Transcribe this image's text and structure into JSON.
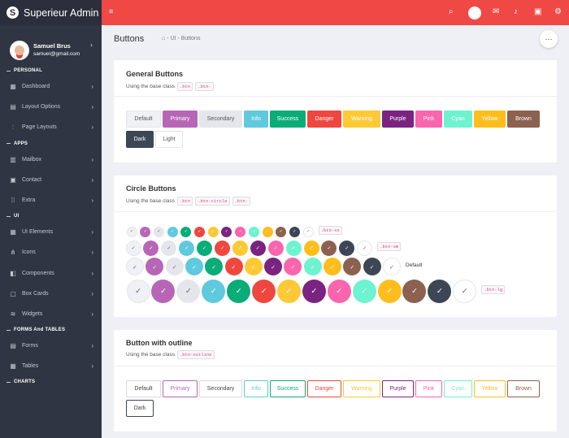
{
  "app": {
    "title": "Superieur Admin"
  },
  "user": {
    "name": "Samuel Brus",
    "email": "samuel@gmail.com"
  },
  "sidebar": {
    "sections": [
      "PERSONAL",
      "APPS",
      "UI",
      "FORMS And TABLES",
      "CHARTS"
    ],
    "items": [
      {
        "label": "Dashboard",
        "icon": "grid"
      },
      {
        "label": "Layout Options",
        "icon": "layout"
      },
      {
        "label": "Page Layouts",
        "icon": "sliders"
      },
      {
        "label": "Mailbox",
        "icon": "inbox"
      },
      {
        "label": "Contact",
        "icon": "id-card"
      },
      {
        "label": "Extra",
        "icon": "apps"
      },
      {
        "label": "UI Elements",
        "icon": "layers"
      },
      {
        "label": "Icons",
        "icon": "share"
      },
      {
        "label": "Components",
        "icon": "toggle"
      },
      {
        "label": "Box Cards",
        "icon": "cards"
      },
      {
        "label": "Widgets",
        "icon": "waves"
      },
      {
        "label": "Forms",
        "icon": "form"
      },
      {
        "label": "Tables",
        "icon": "table"
      }
    ]
  },
  "page": {
    "title": "Buttons",
    "breadcrumb": [
      "UI",
      "Buttons"
    ]
  },
  "general": {
    "title": "General Buttons",
    "subtitle": "Using the base class",
    "codes": [
      ".btn",
      ".btn-"
    ]
  },
  "circle": {
    "title": "Circle Buttons",
    "subtitle": "Using the base class",
    "codes": [
      ".btn",
      ".btn-circle",
      ".btn-"
    ],
    "size_labels": [
      ".btn-xs",
      ".btn-sm",
      "Default",
      ".btn-lg"
    ]
  },
  "outline": {
    "title": "Button with outline",
    "subtitle": "Using the base class",
    "codes": [
      ".btn-outline"
    ]
  },
  "buttons": [
    "Default",
    "Primary",
    "Secondary",
    "Info",
    "Success",
    "Danger",
    "Warning",
    "Purple",
    "Pink",
    "Cyan",
    "Yellow",
    "Brown",
    "Dark",
    "Light"
  ],
  "colors": {
    "default": "#f0f1f4",
    "primary": "#b766b6",
    "secondary": "#e4e6eb",
    "info": "#5fc9de",
    "success": "#0aac78",
    "danger": "#ef473f",
    "warning": "#fdc934",
    "purple": "#7a2380",
    "pink": "#fa65ae",
    "cyan": "#6df3cf",
    "yellow": "#fdbe1d",
    "brown": "#8c6150",
    "dark": "#3d4654",
    "light": "#ffffff",
    "topbar": "#f04845",
    "sidebar": "#2f3542"
  }
}
